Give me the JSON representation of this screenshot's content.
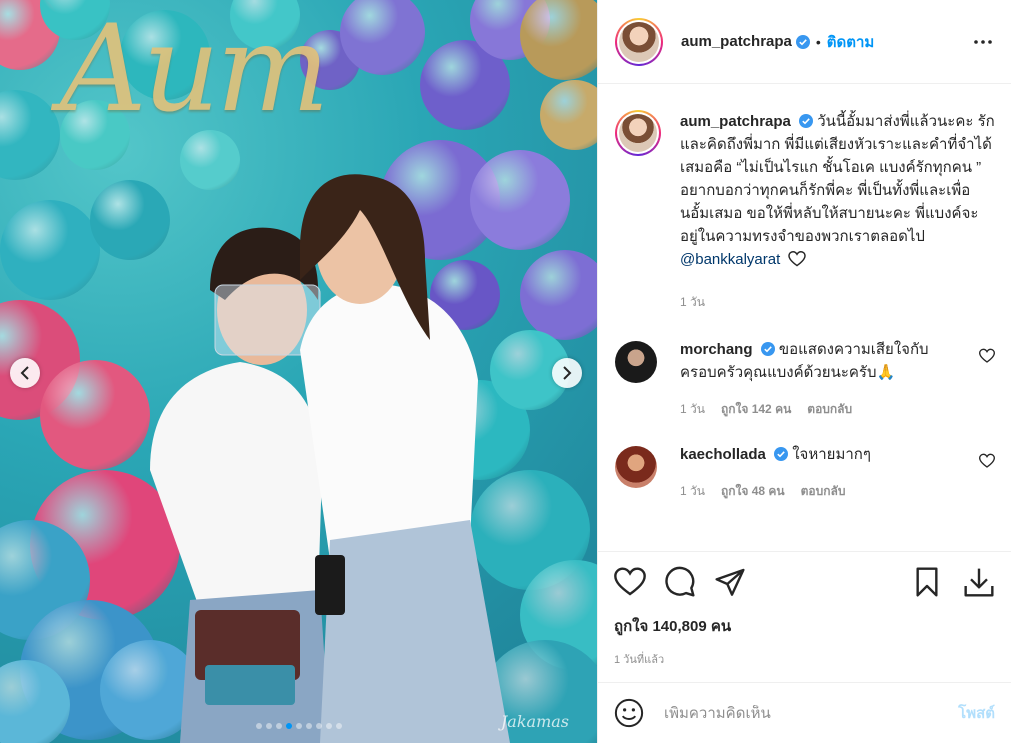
{
  "post": {
    "username": "aum_patchrapa",
    "separator": "•",
    "follow_label": "ติดตาม",
    "photo_signature": "Jakamas",
    "carousel_dots": 9,
    "carousel_active": 3
  },
  "caption": {
    "username": "aum_patchrapa",
    "text": "วันนี้อั้มมาส่งพี่แล้วนะคะ รักและคิดถึงพี่มาก พี่มีแต่เสียงหัวเราะและคำที่จำได้เสมอคือ “ไม่เป็นไรแก ชั้นโอเค แบงค์รักทุกคน ” อยากบอกว่าทุกคนก็รักพี่คะ พี่เป็นทั้งพี่และเพื่อนอั้มเสมอ ขอให้พี่หลับให้สบายนะคะ พี่แบงค์จะอยู่ในความทรงจำของพวกเราตลอดไป",
    "mention": "@bankkalyarat",
    "time": "1 วัน"
  },
  "comments": [
    {
      "username": "morchang",
      "text": "ขอแสดงความเสียใจกับครอบครัวคุณแบงค์ด้วยนะครับ🙏",
      "time": "1 วัน",
      "likes": "ถูกใจ 142 คน",
      "reply": "ตอบกลับ"
    },
    {
      "username": "kaechollada",
      "text": "ใจหายมากๆ",
      "time": "1 วัน",
      "likes": "ถูกใจ 48 คน",
      "reply": "ตอบกลับ"
    }
  ],
  "footer": {
    "likes": "ถูกใจ 140,809 คน",
    "posted_ago": "1 วันที่แล้ว",
    "comment_placeholder": "เพิ่มความคิดเห็น",
    "post_label": "โพสต์"
  },
  "colors": {
    "accent": "#0095f6",
    "verified": "#3897f0",
    "post_disabled": "#b2dffc"
  }
}
